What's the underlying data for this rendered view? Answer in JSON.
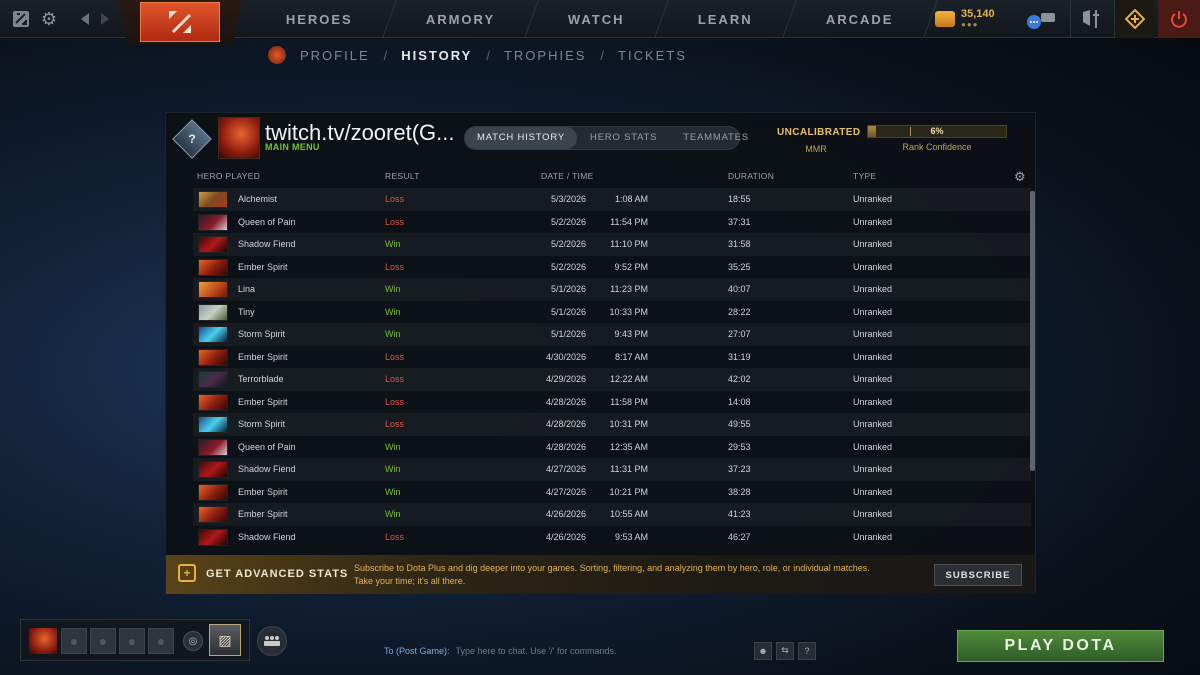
{
  "topbar": {
    "nav": [
      "HEROES",
      "ARMORY",
      "WATCH",
      "LEARN",
      "ARCADE"
    ],
    "currency_amount": "35,140"
  },
  "subnav": [
    "PROFILE",
    "HISTORY",
    "TROPHIES",
    "TICKETS"
  ],
  "profile": {
    "rank_symbol": "?",
    "name": "twitch.tv/zooret(G...",
    "status": "MAIN MENU"
  },
  "tabs": [
    "MATCH HISTORY",
    "HERO STATS",
    "TEAMMATES"
  ],
  "mmr": {
    "value": "UNCALIBRATED",
    "label": "MMR"
  },
  "confidence": {
    "percent": "6%",
    "fraction": 0.06,
    "label": "Rank Confidence"
  },
  "columns": {
    "hero": "HERO PLAYED",
    "result": "RESULT",
    "date": "DATE / TIME",
    "duration": "DURATION",
    "type": "TYPE"
  },
  "matches": [
    {
      "hero": "Alchemist",
      "result": "Loss",
      "date": "5/3/2026",
      "time": "1:08 AM",
      "duration": "18:55",
      "type": "Unranked"
    },
    {
      "hero": "Queen of Pain",
      "result": "Loss",
      "date": "5/2/2026",
      "time": "11:54 PM",
      "duration": "37:31",
      "type": "Unranked"
    },
    {
      "hero": "Shadow Fiend",
      "result": "Win",
      "date": "5/2/2026",
      "time": "11:10 PM",
      "duration": "31:58",
      "type": "Unranked"
    },
    {
      "hero": "Ember Spirit",
      "result": "Loss",
      "date": "5/2/2026",
      "time": "9:52 PM",
      "duration": "35:25",
      "type": "Unranked"
    },
    {
      "hero": "Lina",
      "result": "Win",
      "date": "5/1/2026",
      "time": "11:23 PM",
      "duration": "40:07",
      "type": "Unranked"
    },
    {
      "hero": "Tiny",
      "result": "Win",
      "date": "5/1/2026",
      "time": "10:33 PM",
      "duration": "28:22",
      "type": "Unranked"
    },
    {
      "hero": "Storm Spirit",
      "result": "Win",
      "date": "5/1/2026",
      "time": "9:43 PM",
      "duration": "27:07",
      "type": "Unranked"
    },
    {
      "hero": "Ember Spirit",
      "result": "Loss",
      "date": "4/30/2026",
      "time": "8:17 AM",
      "duration": "31:19",
      "type": "Unranked"
    },
    {
      "hero": "Terrorblade",
      "result": "Loss",
      "date": "4/29/2026",
      "time": "12:22 AM",
      "duration": "42:02",
      "type": "Unranked"
    },
    {
      "hero": "Ember Spirit",
      "result": "Loss",
      "date": "4/28/2026",
      "time": "11:58 PM",
      "duration": "14:08",
      "type": "Unranked"
    },
    {
      "hero": "Storm Spirit",
      "result": "Loss",
      "date": "4/28/2026",
      "time": "10:31 PM",
      "duration": "49:55",
      "type": "Unranked"
    },
    {
      "hero": "Queen of Pain",
      "result": "Win",
      "date": "4/28/2026",
      "time": "12:35 AM",
      "duration": "29:53",
      "type": "Unranked"
    },
    {
      "hero": "Shadow Fiend",
      "result": "Win",
      "date": "4/27/2026",
      "time": "11:31 PM",
      "duration": "37:23",
      "type": "Unranked"
    },
    {
      "hero": "Ember Spirit",
      "result": "Win",
      "date": "4/27/2026",
      "time": "10:21 PM",
      "duration": "38:28",
      "type": "Unranked"
    },
    {
      "hero": "Ember Spirit",
      "result": "Win",
      "date": "4/26/2026",
      "time": "10:55 AM",
      "duration": "41:23",
      "type": "Unranked"
    },
    {
      "hero": "Shadow Fiend",
      "result": "Loss",
      "date": "4/26/2026",
      "time": "9:53 AM",
      "duration": "46:27",
      "type": "Unranked"
    }
  ],
  "advanced": {
    "title": "GET ADVANCED STATS",
    "text": "Subscribe to Dota Plus and dig deeper into your games. Sorting, filtering, and analyzing them by hero, role, or individual matches. Take your time; it's all there.",
    "button": "SUBSCRIBE"
  },
  "chat": {
    "to": "To (Post Game):",
    "placeholder": "Type here to chat. Use '/' for commands."
  },
  "play_button": "PLAY DOTA",
  "colors": {
    "loss": "#e0544a",
    "win": "#76bf3c",
    "accent_gold": "#e8b040",
    "play_green": "#4f8a3a"
  },
  "hero_colors": {
    "Alchemist": "linear-gradient(135deg,#c9a04a,#7d4a1e 50%,#a83a2a)",
    "Queen of Pain": "linear-gradient(135deg,#2a1a24,#8a1c2a 55%,#d8d0d8)",
    "Shadow Fiend": "linear-gradient(135deg,#3a0a0a,#b01818 50%,#1a0404)",
    "Ember Spirit": "linear-gradient(135deg,#e8642c,#8a1c0e 55%,#2a0a06)",
    "Lina": "linear-gradient(135deg,#f0a040,#c04a1c 55%,#6a1a0a)",
    "Tiny": "linear-gradient(135deg,#8a9aa8,#c8d0c0 50%,#4a5a3a)",
    "Storm Spirit": "linear-gradient(135deg,#1a4a8a,#4ad0f0 50%,#0a1a3a)",
    "Terrorblade": "linear-gradient(135deg,#1a3a3a,#4a2a4a 50%,#0a1a1a)"
  }
}
